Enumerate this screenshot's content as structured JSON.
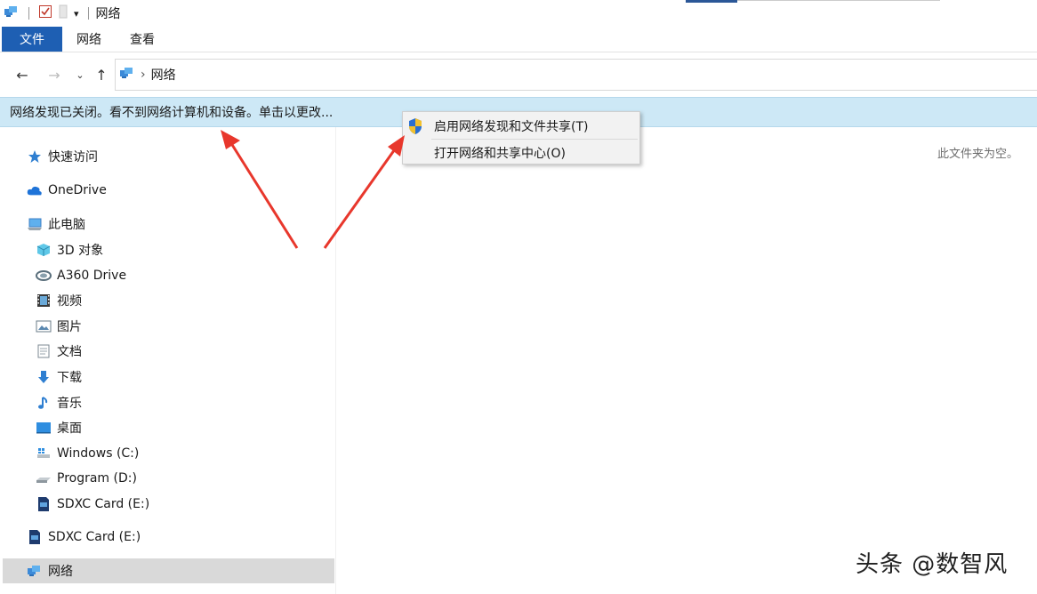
{
  "window": {
    "title": "网络"
  },
  "ribbon": {
    "tabs": [
      {
        "label": "文件"
      },
      {
        "label": "网络"
      },
      {
        "label": "查看"
      }
    ]
  },
  "address": {
    "path_item": "网络",
    "separator": "›"
  },
  "infobar": {
    "text": "网络发现已关闭。看不到网络计算机和设备。单击以更改..."
  },
  "sidebar": {
    "items": [
      {
        "label": "快速访问",
        "icon": "star-icon"
      },
      {
        "label": "OneDrive",
        "icon": "cloud-icon"
      },
      {
        "label": "此电脑",
        "icon": "computer-icon"
      },
      {
        "label": "3D 对象",
        "icon": "3d-objects-icon"
      },
      {
        "label": "A360 Drive",
        "icon": "a360-drive-icon"
      },
      {
        "label": "视频",
        "icon": "video-icon"
      },
      {
        "label": "图片",
        "icon": "pictures-icon"
      },
      {
        "label": "文档",
        "icon": "documents-icon"
      },
      {
        "label": "下载",
        "icon": "download-icon"
      },
      {
        "label": "音乐",
        "icon": "music-icon"
      },
      {
        "label": "桌面",
        "icon": "desktop-icon"
      },
      {
        "label": "Windows (C:)",
        "icon": "drive-c-icon"
      },
      {
        "label": "Program (D:)",
        "icon": "drive-d-icon"
      },
      {
        "label": "SDXC Card (E:)",
        "icon": "sd-card-icon"
      },
      {
        "label": "SDXC Card (E:)",
        "icon": "sd-card-icon"
      },
      {
        "label": "网络",
        "icon": "network-icon"
      }
    ]
  },
  "main": {
    "empty_text": "此文件夹为空。"
  },
  "context_menu": {
    "items": [
      {
        "label": "启用网络发现和文件共享(T)",
        "icon": "uac-shield-icon"
      },
      {
        "label": "打开网络和共享中心(O)"
      }
    ]
  },
  "watermark": {
    "text": "头条 @数智风"
  },
  "colors": {
    "file_tab": "#1e5fb3",
    "infobar_bg": "#cde8f6",
    "arrow": "#e8372c",
    "selected_bg": "#d9d9d9"
  }
}
